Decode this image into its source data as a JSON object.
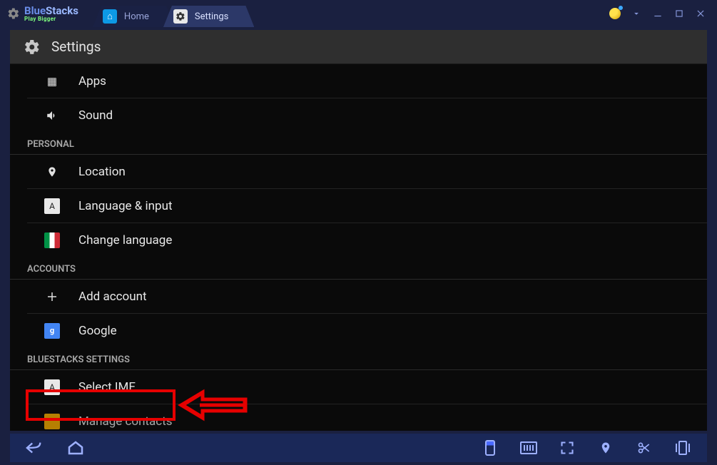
{
  "logo": {
    "brand": "BlueStacks",
    "tagline": "Play Bigger"
  },
  "tabs": {
    "home": "Home",
    "settings": "Settings"
  },
  "header": {
    "title": "Settings"
  },
  "sections": {
    "device": {
      "apps": "Apps",
      "sound": "Sound"
    },
    "personal": {
      "header": "PERSONAL",
      "location": "Location",
      "language_input": "Language & input",
      "change_language": "Change language"
    },
    "accounts": {
      "header": "ACCOUNTS",
      "add_account": "Add account",
      "google": "Google"
    },
    "bluestacks": {
      "header": "BLUESTACKS SETTINGS",
      "select_ime": "Select IME",
      "manage_contacts": "Manage contacts"
    }
  }
}
